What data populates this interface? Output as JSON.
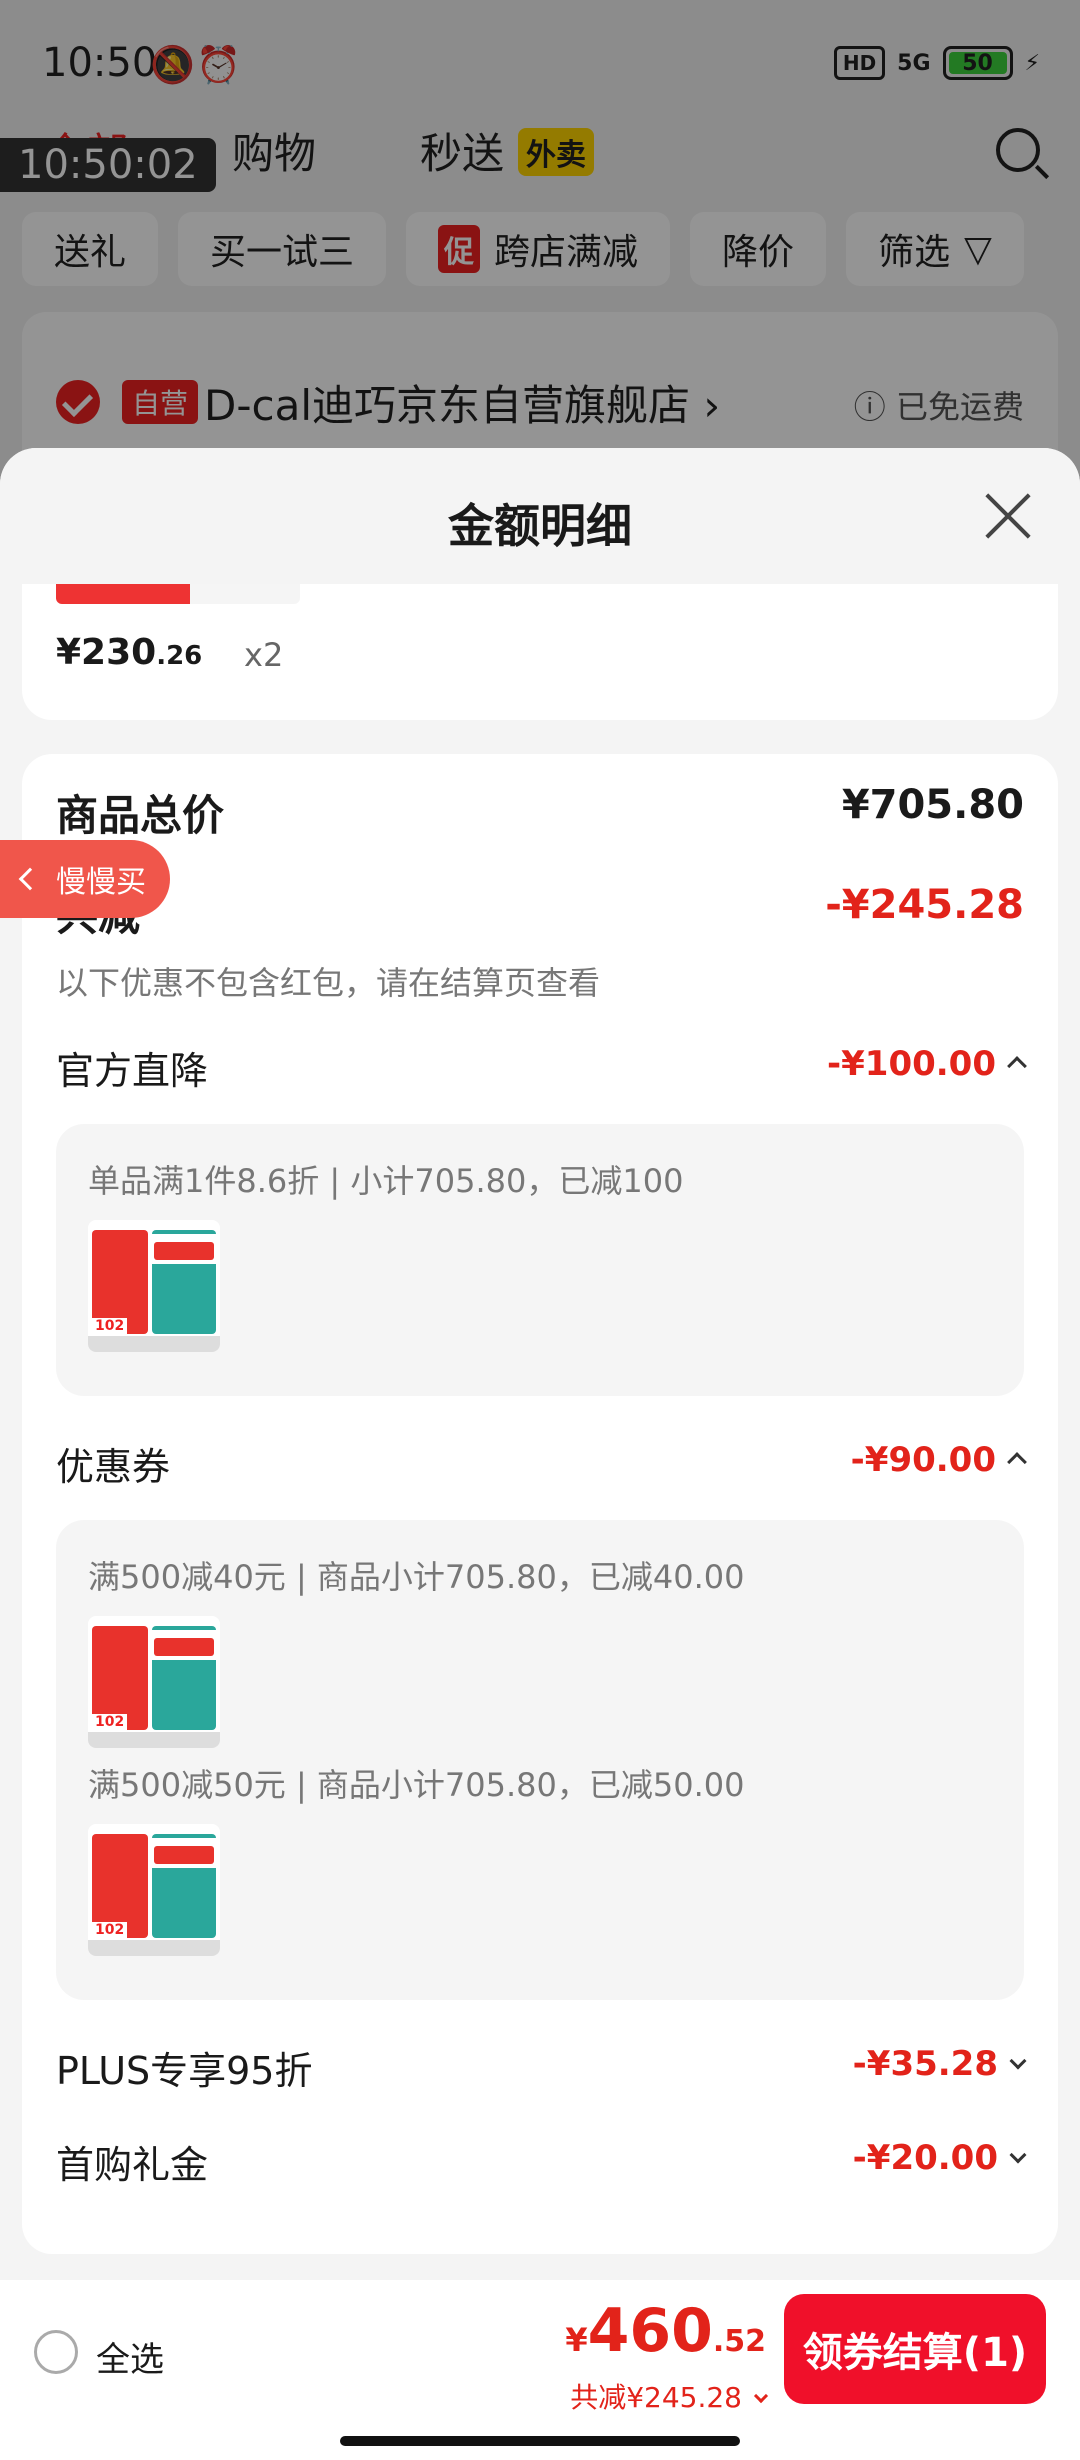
{
  "status": {
    "time": "10:50",
    "network": "5G",
    "hd": "HD",
    "battery": "50"
  },
  "overlay_timestamp": "10:50:02",
  "top_tabs": [
    {
      "label": "全部"
    },
    {
      "label": "购物"
    },
    {
      "label": "秒送"
    }
  ],
  "takeout_badge": "外卖",
  "filters": {
    "gift": "送礼",
    "trial": "买一试三",
    "promo_tag": "促",
    "cross_store": "跨店满减",
    "price_drop": "降价",
    "filter": "筛选"
  },
  "store": {
    "tag": "自营",
    "name": "D-cal迪巧京东自营旗舰店",
    "shipping": "已免运费"
  },
  "sheet": {
    "title": "金额明细"
  },
  "item": {
    "price_int": "¥230",
    "price_dec": ".26",
    "qty": "x2"
  },
  "side_pill": "慢慢买",
  "detail": {
    "total_label": "商品总价",
    "total_value": "¥705.80",
    "discount_label": "共减",
    "discount_value": "-¥245.28",
    "note": "以下优惠不包含红包，请在结算页查看",
    "official_label": "官方直降",
    "official_value": "-¥100.00",
    "official_line": "单品满1件8.6折 | 小计705.80，已减100",
    "coupon_label": "优惠券",
    "coupon_value": "-¥90.00",
    "coupon_line1": "满500减40元 | 商品小计705.80，已减40.00",
    "coupon_line2": "满500减50元 | 商品小计705.80，已减50.00",
    "plus_label": "PLUS专享95折",
    "plus_value": "-¥35.28",
    "gift_label": "首购礼金",
    "gift_value": "-¥20.00"
  },
  "bottom": {
    "select_all": "全选",
    "currency": "¥",
    "total_int": "460",
    "total_dec": ".52",
    "saved": "共减¥245.28",
    "checkout": "领券结算(1)"
  },
  "thumb_badge": "102"
}
